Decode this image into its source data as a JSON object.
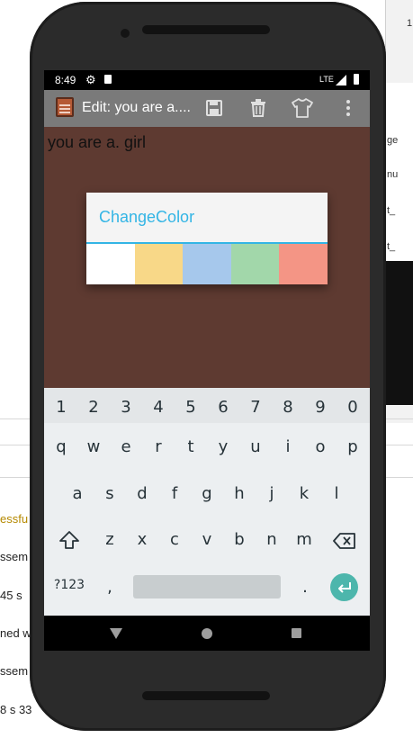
{
  "background": {
    "right_labels": [
      "ge",
      "nu",
      "t_",
      "t_"
    ],
    "top_char": "1",
    "build_lines": [
      {
        "text": "essfu",
        "color": "#b58900"
      },
      {
        "text": "ssem",
        "color": "#222222"
      },
      {
        "text": "45 s",
        "color": "#222222"
      },
      {
        "text": "ned w",
        "color": "#222222"
      },
      {
        "text": "ssem",
        "color": "#222222"
      },
      {
        "text": "8 s 33",
        "color": "#222222"
      }
    ]
  },
  "status_bar": {
    "time": "8:49",
    "network": "LTE"
  },
  "app_bar": {
    "title": "Edit: you are a....",
    "actions": [
      "save-icon",
      "delete-icon",
      "shirt-icon",
      "overflow-menu-icon"
    ]
  },
  "editor": {
    "text": "you are a. girl",
    "background_color": "#5e3a31"
  },
  "dialog": {
    "title": "ChangeColor",
    "accent_color": "#33b5e5",
    "colors": [
      "#ffffff",
      "#f8d888",
      "#a6c8ec",
      "#a2d7aa",
      "#f49585"
    ]
  },
  "keyboard": {
    "number_row": [
      "1",
      "2",
      "3",
      "4",
      "5",
      "6",
      "7",
      "8",
      "9",
      "0"
    ],
    "row1": [
      "q",
      "w",
      "e",
      "r",
      "t",
      "y",
      "u",
      "i",
      "o",
      "p"
    ],
    "row2": [
      "a",
      "s",
      "d",
      "f",
      "g",
      "h",
      "j",
      "k",
      "l"
    ],
    "row3": [
      "z",
      "x",
      "c",
      "v",
      "b",
      "n",
      "m"
    ],
    "symbols_label": "?123",
    "comma": ",",
    "period": "."
  }
}
